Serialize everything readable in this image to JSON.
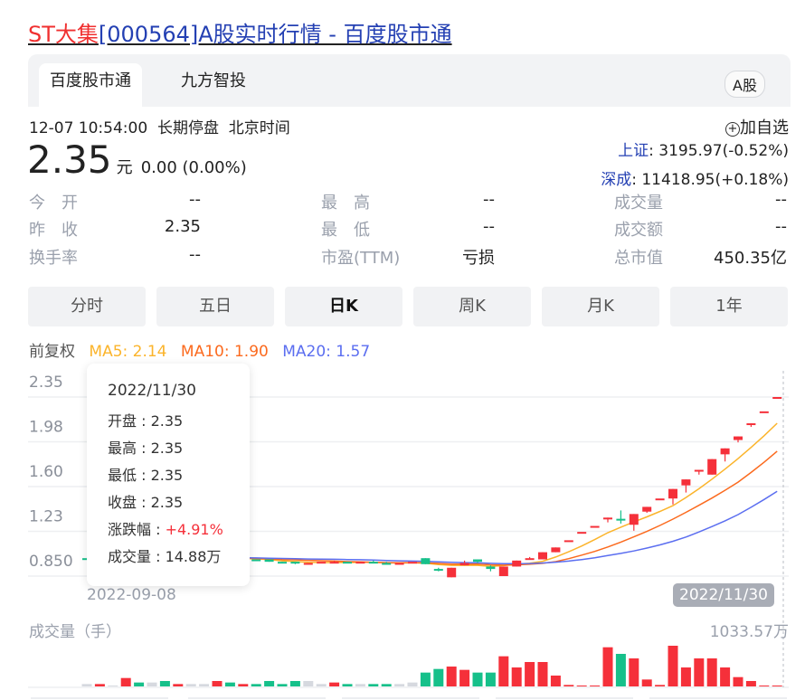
{
  "title": {
    "stock": "ST大集",
    "rest": "[000564]A股实时行情 - 百度股市通"
  },
  "tabs": [
    "百度股市通",
    "九方智投"
  ],
  "market_badge": "A股",
  "status": {
    "time": "12-07 10:54:00",
    "state": "长期停盘",
    "tz": "北京时间"
  },
  "price": {
    "value": "2.35",
    "unit": "元",
    "change": "0.00 (0.00%)"
  },
  "add_watch": "加自选",
  "indices": [
    {
      "name": "上证",
      "value": ": 3195.97(-0.52%)"
    },
    {
      "name": "深成",
      "value": ": 11418.95(+0.18%)"
    }
  ],
  "stats": [
    [
      {
        "label": "今　开",
        "value": "--"
      },
      {
        "label": "最　高",
        "value": "--"
      },
      {
        "label": "成交量",
        "value": "--"
      }
    ],
    [
      {
        "label": "昨　收",
        "value": "2.35"
      },
      {
        "label": "最　低",
        "value": "--"
      },
      {
        "label": "成交额",
        "value": "--"
      }
    ],
    [
      {
        "label": "换手率",
        "value": "--"
      },
      {
        "label": "市盈(TTM)",
        "value": "亏损"
      },
      {
        "label": "总市值",
        "value": "450.35亿"
      }
    ]
  ],
  "periods": [
    "分时",
    "五日",
    "日K",
    "周K",
    "月K",
    "1年"
  ],
  "active_period": 2,
  "ma": {
    "adj": "前复权",
    "ma5": "MA5: 2.14",
    "ma10": "MA10: 1.90",
    "ma20": "MA20: 1.57"
  },
  "colors": {
    "up": "#f5303a",
    "down": "#16c08a",
    "flat": "#d6d9df",
    "ma5": "#fbb42b",
    "ma10": "#fb6a1e",
    "ma20": "#5b6ef0"
  },
  "tooltip": {
    "date": "2022/11/30",
    "open": "开盘 : 2.35",
    "high": "最高 : 2.35",
    "low": "最低 : 2.35",
    "close": "收盘 : 2.35",
    "chg_label": "涨跌幅 : ",
    "chg": "+4.91%",
    "vol": "成交量 : 14.88万"
  },
  "volume_label": "成交量（手）",
  "volume_max": "1033.57万",
  "chart_data": {
    "type": "candlestick",
    "y_ticks": [
      "2.35",
      "1.98",
      "1.60",
      "1.23",
      "0.850"
    ],
    "ylim": [
      0.85,
      2.35
    ],
    "x_labels": {
      "start": "2022-09-08",
      "cursor": "2022/11/30"
    },
    "candles": [
      [
        1.0,
        1.0,
        1.0,
        1.0
      ],
      [
        1.0,
        1.01,
        1.01,
        1.0
      ],
      [
        1.01,
        1.01,
        1.01,
        1.01
      ],
      [
        1.0,
        1.03,
        1.04,
        1.0
      ],
      [
        1.03,
        1.01,
        1.03,
        1.0
      ],
      [
        1.01,
        1.01,
        1.01,
        1.01
      ],
      [
        1.01,
        0.99,
        1.02,
        0.99
      ],
      [
        0.99,
        1.0,
        1.0,
        0.99
      ],
      [
        1.0,
        1.0,
        1.0,
        1.0
      ],
      [
        1.0,
        1.0,
        1.0,
        1.0
      ],
      [
        0.99,
        1.01,
        1.02,
        0.99
      ],
      [
        1.01,
        0.99,
        1.01,
        0.98
      ],
      [
        0.98,
        0.99,
        0.99,
        0.98
      ],
      [
        0.99,
        0.98,
        0.99,
        0.98
      ],
      [
        0.99,
        0.97,
        0.99,
        0.97
      ],
      [
        0.97,
        0.96,
        0.97,
        0.96
      ],
      [
        0.97,
        0.96,
        0.97,
        0.95
      ],
      [
        0.96,
        0.96,
        0.96,
        0.96
      ],
      [
        0.97,
        0.97,
        0.97,
        0.97
      ],
      [
        0.96,
        0.97,
        0.98,
        0.96
      ],
      [
        0.97,
        0.96,
        0.97,
        0.96
      ],
      [
        0.97,
        0.97,
        0.97,
        0.97
      ],
      [
        0.97,
        0.96,
        0.98,
        0.96
      ],
      [
        0.96,
        0.95,
        0.97,
        0.95
      ],
      [
        0.96,
        0.96,
        0.96,
        0.96
      ],
      [
        0.97,
        0.97,
        0.97,
        0.97
      ],
      [
        1.0,
        0.95,
        1.0,
        0.95
      ],
      [
        0.91,
        0.9,
        0.92,
        0.89
      ],
      [
        0.84,
        0.92,
        0.92,
        0.84
      ],
      [
        0.94,
        0.96,
        0.98,
        0.94
      ],
      [
        0.99,
        0.97,
        0.99,
        0.96
      ],
      [
        0.93,
        0.91,
        0.94,
        0.89
      ],
      [
        0.85,
        0.93,
        0.93,
        0.85
      ],
      [
        0.93,
        0.98,
        0.98,
        0.93
      ],
      [
        1.0,
        1.0,
        1.01,
        0.99
      ],
      [
        0.99,
        1.05,
        1.05,
        0.99
      ],
      [
        1.05,
        1.09,
        1.09,
        1.05
      ],
      [
        1.15,
        1.15,
        1.15,
        1.15
      ],
      [
        1.22,
        1.22,
        1.22,
        1.22
      ],
      [
        1.27,
        1.27,
        1.27,
        1.27
      ],
      [
        1.33,
        1.34,
        1.34,
        1.3
      ],
      [
        1.33,
        1.32,
        1.4,
        1.29
      ],
      [
        1.28,
        1.37,
        1.37,
        1.23
      ],
      [
        1.39,
        1.43,
        1.43,
        1.38
      ],
      [
        1.5,
        1.5,
        1.5,
        1.5
      ],
      [
        1.5,
        1.58,
        1.58,
        1.45
      ],
      [
        1.61,
        1.66,
        1.66,
        1.55
      ],
      [
        1.74,
        1.74,
        1.74,
        1.7
      ],
      [
        1.7,
        1.83,
        1.83,
        1.7
      ],
      [
        1.87,
        1.92,
        1.92,
        1.81
      ],
      [
        1.99,
        2.02,
        2.02,
        1.97
      ],
      [
        2.13,
        2.13,
        2.13,
        2.1
      ],
      [
        2.23,
        2.23,
        2.23,
        2.23
      ],
      [
        2.35,
        2.35,
        2.35,
        2.35
      ]
    ],
    "volumes": [
      61,
      61,
      23,
      214,
      100,
      100,
      138,
      61,
      61,
      61,
      138,
      100,
      61,
      61,
      138,
      61,
      138,
      138,
      61,
      100,
      61,
      61,
      61,
      61,
      61,
      100,
      352,
      444,
      505,
      421,
      352,
      352,
      766,
      482,
      620,
      620,
      276,
      38,
      23,
      23,
      995,
      827,
      712,
      176,
      38,
      1033.57,
      482,
      712,
      712,
      482,
      237,
      138,
      23,
      14.88
    ],
    "volume_dir": [
      "flat",
      "up",
      "flat",
      "up",
      "down",
      "flat",
      "down",
      "up",
      "flat",
      "flat",
      "up",
      "down",
      "up",
      "down",
      "down",
      "down",
      "down",
      "flat",
      "flat",
      "up",
      "down",
      "flat",
      "down",
      "down",
      "flat",
      "flat",
      "down",
      "down",
      "up",
      "up",
      "down",
      "down",
      "up",
      "up",
      "up",
      "up",
      "up",
      "up",
      "up",
      "up",
      "up",
      "down",
      "up",
      "up",
      "up",
      "up",
      "up",
      "up",
      "up",
      "up",
      "up",
      "up",
      "up",
      "up"
    ]
  }
}
